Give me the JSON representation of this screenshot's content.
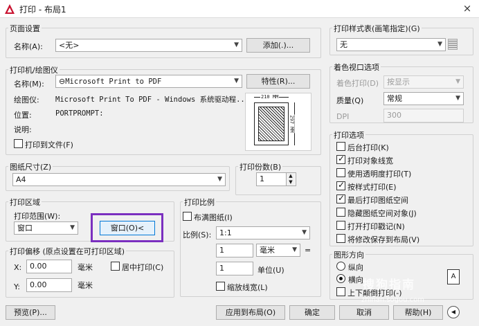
{
  "window": {
    "title": "打印 - 布局1",
    "close": "×"
  },
  "page_setup": {
    "group": "页面设置",
    "name_label": "名称(A):",
    "name_value": "<无>",
    "add_button": "添加(.)..."
  },
  "printer": {
    "group": "打印机/绘图仪",
    "name_label": "名称(M):",
    "name_value": "Microsoft Print to PDF",
    "properties_button": "特性(R)...",
    "plotter_label": "绘图仪:",
    "plotter_value": "Microsoft Print To PDF - Windows 系统驱动程...",
    "location_label": "位置:",
    "location_value": "PORTPROMPT:",
    "desc_label": "说明:",
    "print_to_file": "打印到文件(F)",
    "preview_width": "210 MM",
    "preview_height": "297 MM"
  },
  "paper_size": {
    "group": "图纸尺寸(Z)",
    "value": "A4"
  },
  "copies": {
    "group": "打印份数(B)",
    "value": "1"
  },
  "plot_area": {
    "group": "打印区域",
    "range_label": "打印范围(W):",
    "range_value": "窗口",
    "window_button": "窗口(O)<"
  },
  "plot_offset": {
    "group": "打印偏移 (原点设置在可打印区域)",
    "x_label": "X:",
    "x_value": "0.00",
    "x_unit": "毫米",
    "y_label": "Y:",
    "y_value": "0.00",
    "y_unit": "毫米",
    "center": "居中打印(C)"
  },
  "plot_scale": {
    "group": "打印比例",
    "fit": "布满图纸(I)",
    "scale_label": "比例(S):",
    "scale_value": "1:1",
    "value1": "1",
    "unit1": "毫米",
    "equals": "=",
    "value2": "1",
    "unit2": "单位(U)",
    "lineweights": "缩放线宽(L)"
  },
  "style_table": {
    "group": "打印样式表(画笔指定)(G)",
    "value": "无"
  },
  "shaded": {
    "group": "着色视口选项",
    "shade_label": "着色打印(D)",
    "shade_value": "按显示",
    "quality_label": "质量(Q)",
    "quality_value": "常规",
    "dpi_label": "DPI",
    "dpi_value": "300"
  },
  "options": {
    "group": "打印选项",
    "items": [
      {
        "label": "后台打印(K)",
        "checked": false
      },
      {
        "label": "打印对象线宽",
        "checked": true
      },
      {
        "label": "使用透明度打印(T)",
        "checked": false
      },
      {
        "label": "按样式打印(E)",
        "checked": true
      },
      {
        "label": "最后打印图纸空间",
        "checked": true
      },
      {
        "label": "隐藏图纸空间对象(J)",
        "checked": false
      },
      {
        "label": "打开打印戳记(N)",
        "checked": false
      },
      {
        "label": "将修改保存到布局(V)",
        "checked": false
      }
    ]
  },
  "orientation": {
    "group": "图形方向",
    "portrait": "纵向",
    "landscape": "横向",
    "upside_down": "上下颠倒打印(-)",
    "icon_letter": "A"
  },
  "footer": {
    "preview": "预览(P)...",
    "apply": "应用到布局(O)",
    "ok": "确定",
    "cancel": "取消",
    "help": "帮助(H)"
  },
  "watermark": {
    "brand": "搜狗指南",
    "url": "zhinan.sogou.com"
  }
}
